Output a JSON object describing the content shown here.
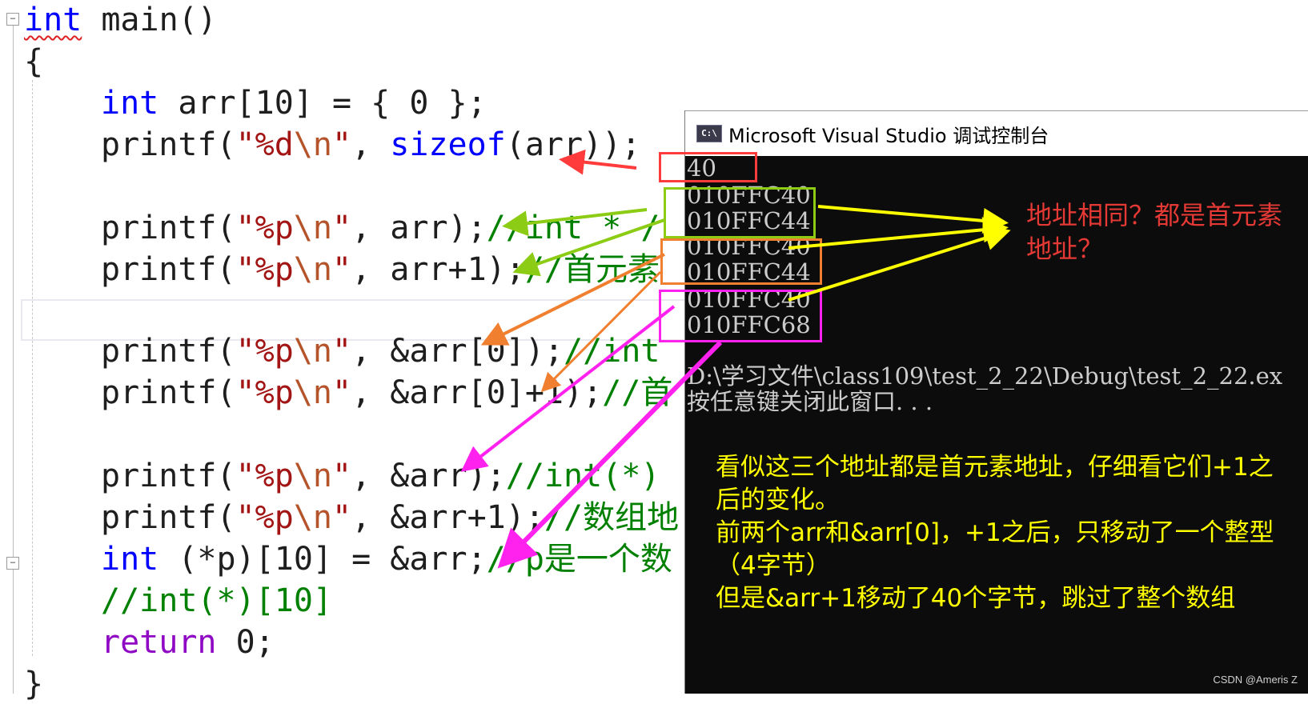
{
  "editor": {
    "fold_symbol": "−",
    "lines": {
      "l1": {
        "kw": "int",
        "rest": " main()"
      },
      "l2": {
        "text": "{"
      },
      "l3": {
        "kw": "int",
        "a": " arr[10] = { 0 };"
      },
      "l4": {
        "fn": "printf(",
        "s1": "\"%d",
        "e1": "\\n",
        "s2": "\"",
        "a": ", ",
        "kw": "sizeof",
        "b": "(arr));"
      },
      "l5": {
        "fn": "printf(",
        "s1": "\"%p",
        "e1": "\\n",
        "s2": "\"",
        "a": ", arr);",
        "c": "//int * /"
      },
      "l6": {
        "fn": "printf(",
        "s1": "\"%p",
        "e1": "\\n",
        "s2": "\"",
        "a": ", arr+1);",
        "c": "//首元素"
      },
      "l7": {
        "fn": "printf(",
        "s1": "\"%p",
        "e1": "\\n",
        "s2": "\"",
        "a": ", &arr[0]);",
        "c": "//int"
      },
      "l8": {
        "fn": "printf(",
        "s1": "\"%p",
        "e1": "\\n",
        "s2": "\"",
        "a": ", &arr[0]+1);",
        "c": "//首"
      },
      "l9": {
        "fn": "printf(",
        "s1": "\"%p",
        "e1": "\\n",
        "s2": "\"",
        "a": ", &arr);",
        "c": "//int(*)"
      },
      "l10": {
        "fn": "printf(",
        "s1": "\"%p",
        "e1": "\\n",
        "s2": "\"",
        "a": ", &arr+1);",
        "c": "//数组地"
      },
      "l11": {
        "kw": "int",
        "a": " (*p)[10] = &arr;",
        "c": "//p是一个数"
      },
      "l12": {
        "c": "//int(*)[10]"
      },
      "l13": {
        "ctl": "return",
        "a": " 0;"
      },
      "l14": {
        "text": "}"
      }
    }
  },
  "console": {
    "icon_label": "C:\\",
    "title": "Microsoft Visual Studio 调试控制台",
    "output": [
      "40",
      "010FFC40",
      "010FFC44",
      "010FFC40",
      "010FFC44",
      "010FFC40",
      "010FFC68",
      "",
      "D:\\学习文件\\class109\\test_2_22\\Debug\\test_2_22.ex",
      "按任意键关闭此窗口. . ."
    ],
    "note_lines": [
      "看似这三个地址都是首元素地址，仔细看它们+1之",
      "后的变化。",
      "前两个arr和&arr[0]，+1之后，只移动了一个整型",
      "（4字节）",
      "但是&arr+1移动了40个字节，跳过了整个数组"
    ],
    "watermark": "CSDN @Ameris Z"
  },
  "annotation": {
    "question": "地址相同？都是首元素\n地址？"
  },
  "colors": {
    "red": "#ff3b3b",
    "green": "#8ccc14",
    "orange": "#f08030",
    "magenta": "#ff22ee",
    "yellow": "#ffff00"
  }
}
